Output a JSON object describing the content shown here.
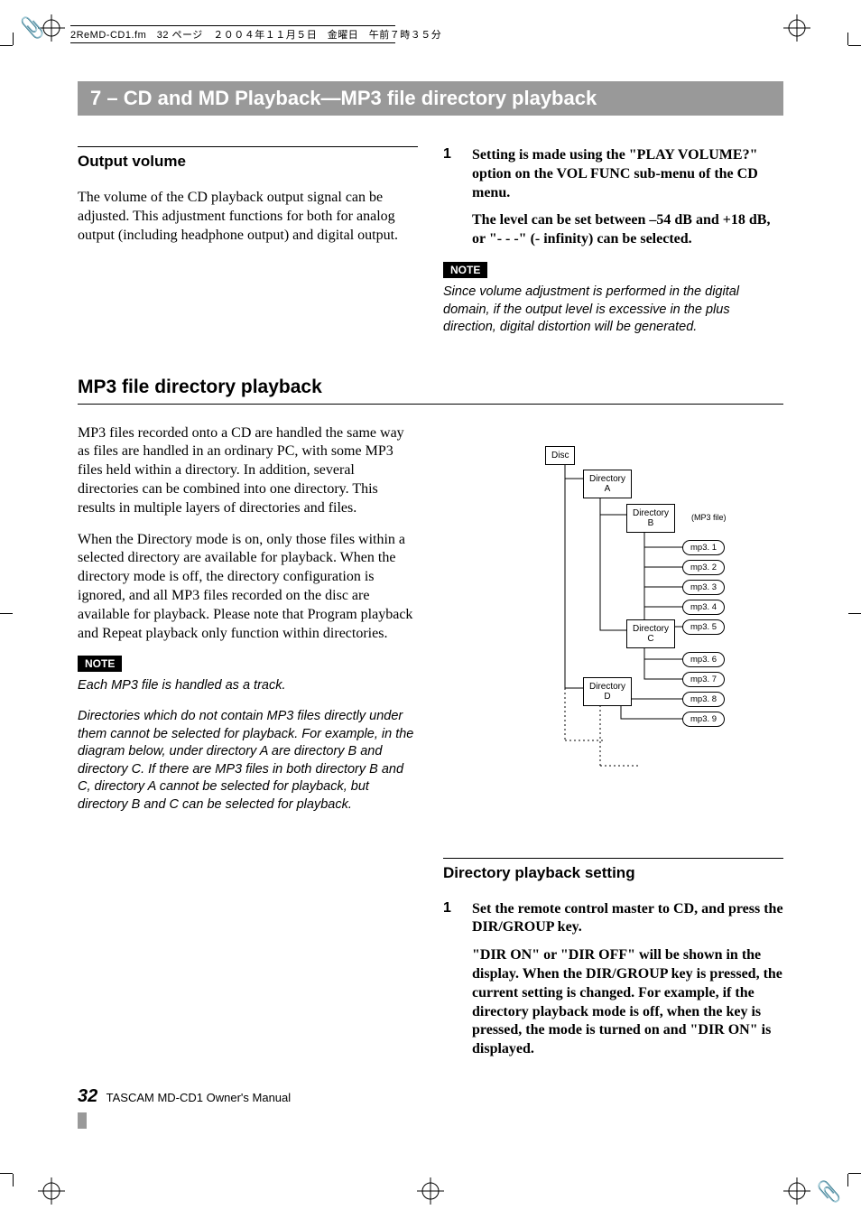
{
  "meta": {
    "filename_line": "2ReMD-CD1.fm　32 ページ　２００４年１１月５日　金曜日　午前７時３５分"
  },
  "title_bar": "7 – CD and MD Playback—MP3 file directory playback",
  "left": {
    "output_volume_h": "Output volume",
    "ov_p1": "The volume of the CD playback output signal can be adjusted. This adjustment functions for both for analog output (including headphone output) and digital output.",
    "mp3_h": "MP3 file directory playback",
    "mp3_p1": "MP3 files recorded onto a CD are handled the same way as files are handled in an ordinary PC, with some MP3 files held within a directory. In addition, several directories can be combined into one directory. This results in multiple layers of directories and files.",
    "mp3_p2": "When the Directory mode is on, only those files within a selected directory are available for playback. When the directory mode is off, the directory configuration is ignored, and all MP3 files recorded on the disc are available for playback. Please note that Program playback and Repeat playback only function within directories.",
    "note_label": "NOTE",
    "note_p1": "Each MP3 file is handled as a track.",
    "note_p2": "Directories which do not contain MP3 files directly under them cannot be selected for playback. For example, in the diagram below, under directory A are directory B and directory C. If there are MP3 files in both directory B and C, directory A cannot be selected for playback, but directory B and C can be selected for playback."
  },
  "right": {
    "step1_num": "1",
    "step1_text": "Setting is made using the \"PLAY VOLUME?\" option on the VOL FUNC sub-menu of the CD menu.",
    "step1_sub": "The level can be set between –54 dB and +18 dB, or \"- - -\" (- infinity) can be selected.",
    "note_label": "NOTE",
    "note_p": "Since volume adjustment is performed in the digital domain, if the output level is excessive in the plus direction, digital distortion will be generated.",
    "diagram": {
      "disc": "Disc",
      "dirA": "Directory\nA",
      "dirB": "Directory\nB",
      "dirC": "Directory\nC",
      "dirD": "Directory\nD",
      "mp3_label": "(MP3 file)",
      "f1": "mp3. 1",
      "f2": "mp3. 2",
      "f3": "mp3. 3",
      "f4": "mp3. 4",
      "f5": "mp3. 5",
      "f6": "mp3. 6",
      "f7": "mp3. 7",
      "f8": "mp3. 8",
      "f9": "mp3. 9"
    },
    "dps_h": "Directory playback setting",
    "dps_step1_num": "1",
    "dps_step1_text": "Set the remote control master to CD, and press the DIR/GROUP key.",
    "dps_step1_sub": "\"DIR ON\" or \"DIR OFF\" will be shown in the display. When the DIR/GROUP key is pressed, the current setting is changed. For example, if the directory playback mode is off, when the key is pressed, the mode is turned on and \"DIR ON\" is displayed."
  },
  "footer": {
    "page": "32",
    "text": " TASCAM MD-CD1 Owner's Manual"
  }
}
